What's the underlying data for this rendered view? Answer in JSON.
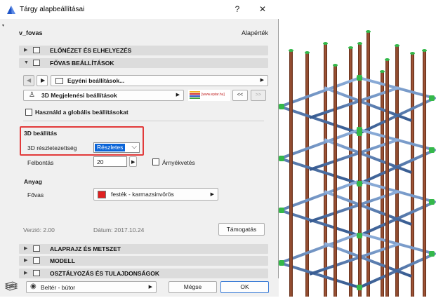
{
  "window": {
    "title": "Tárgy alapbeállításai",
    "help": "?",
    "close": "✕"
  },
  "header": {
    "object_name": "v_fovas",
    "default_label": "Alapérték"
  },
  "sections": {
    "preview": "ELŐNÉZET ÉS ELHELYEZÉS",
    "main": "FŐVAS BEÁLLÍTÁSOK",
    "plan": "ALAPRAJZ ÉS METSZET",
    "model": "MODELL",
    "classification": "OSZTÁLYOZÁS ÉS TULAJDONSÁGOK"
  },
  "custom_settings": {
    "label": "Egyéni beállítások..."
  },
  "display3d": {
    "label": "3D Megjelenési beállítások",
    "url": "[www.eptar.hu]",
    "prev": "<<",
    "next": ">>"
  },
  "global_checkbox": {
    "label": "Használd a globális beállításokat",
    "checked": false
  },
  "settings3d": {
    "heading": "3D beállítás",
    "detail_label": "3D részletezettség",
    "detail_value": "Részletes",
    "resolution_label": "Felbontás",
    "resolution_value": "20",
    "shadow_label": "Árnyékvetés",
    "shadow_checked": false
  },
  "material": {
    "heading": "Anyag",
    "label": "Fővas",
    "value": "festék - karmazsinvörös",
    "swatch_color": "#e02020"
  },
  "footer_info": {
    "version": "Verzió: 2.00",
    "date": "Dátum: 2017.10.24",
    "support": "Támogatás"
  },
  "bottom": {
    "layer": "Beltér - bútor",
    "cancel": "Mégse",
    "ok": "OK"
  },
  "colors": {
    "highlight_border": "#e23a3a",
    "rebar": "#8b4a2c",
    "stirrup": "#4a72b0",
    "joint": "#34b84a"
  }
}
